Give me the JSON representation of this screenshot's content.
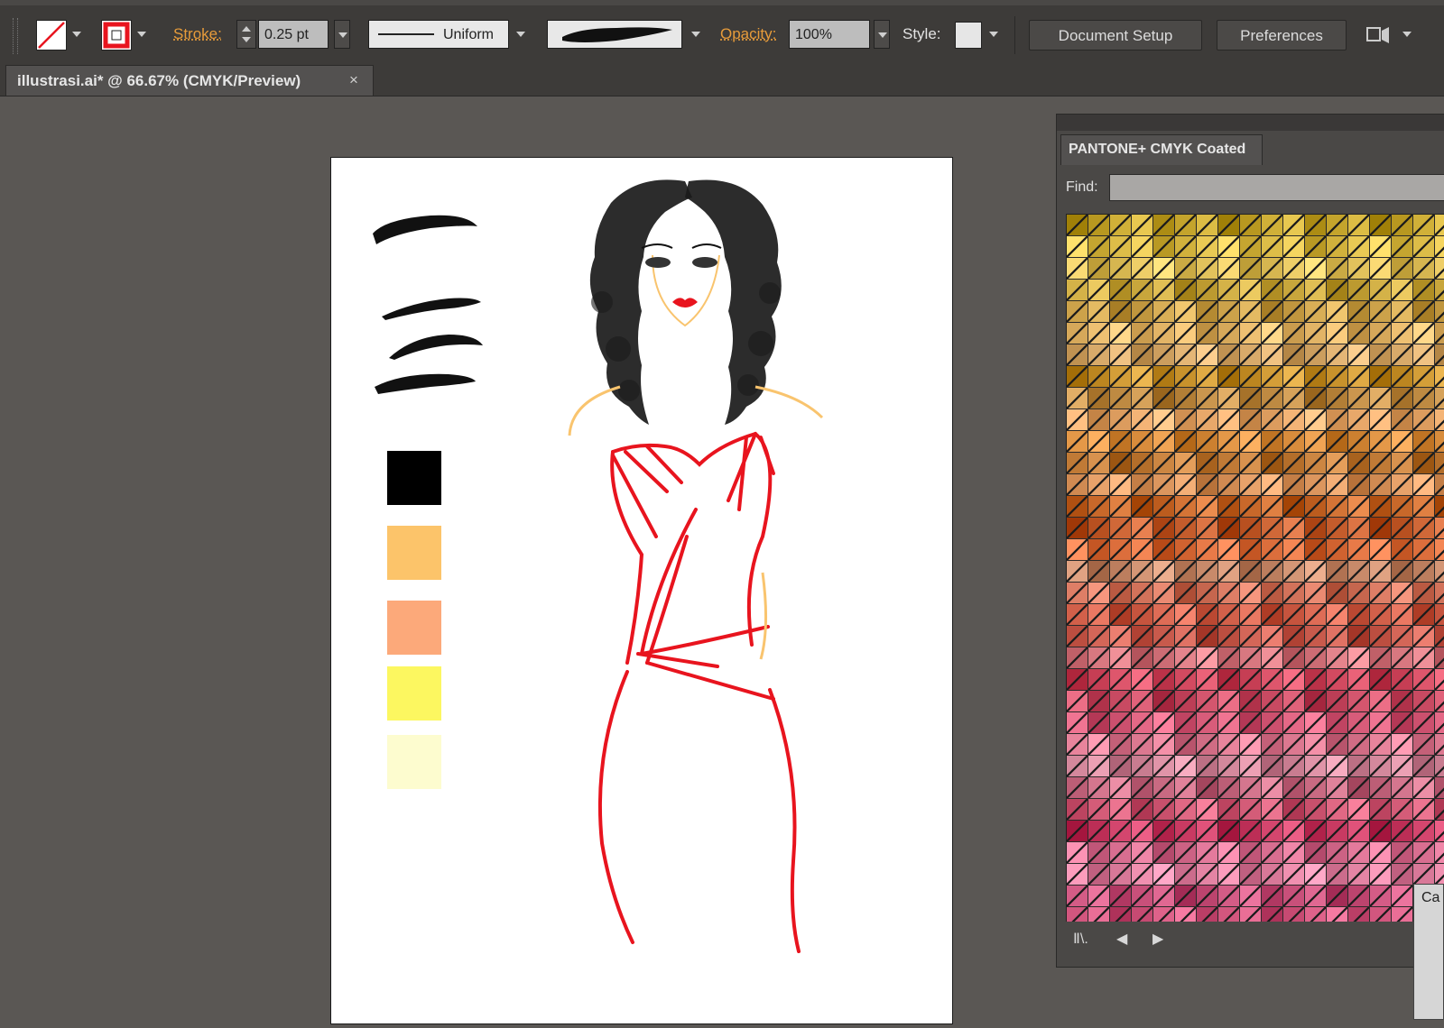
{
  "control_bar": {
    "stroke_label": "Stroke:",
    "stroke_weight": "0.25 pt",
    "profile_label": "Uniform",
    "opacity_label": "Opacity:",
    "opacity_value": "100%",
    "style_label": "Style:",
    "document_setup": "Document Setup",
    "preferences": "Preferences"
  },
  "document_tab": {
    "title": "illustrasi.ai* @ 66.67% (CMYK/Preview)",
    "close": "×"
  },
  "artboard": {
    "swatches": [
      "#000000",
      "#fcc46a",
      "#fca97a",
      "#fcf760",
      "#fdfccf"
    ]
  },
  "swatch_panel": {
    "title": "PANTONE+ CMYK Coated",
    "find_label": "Find:",
    "find_value": "",
    "row_colors": [
      "#c4a42c",
      "#ddbd48",
      "#e2c25c",
      "#c8a63c",
      "#cca24a",
      "#e2b466",
      "#d8aa6a",
      "#c8922c",
      "#be8a42",
      "#e8a86a",
      "#d88c3c",
      "#c07a36",
      "#dc965e",
      "#c8682a",
      "#c45c2c",
      "#dc6e3c",
      "#c88a6a",
      "#d2725a",
      "#d2604a",
      "#c85a4c",
      "#d87880",
      "#d24a60",
      "#c84a62",
      "#d85c7a",
      "#dc7890",
      "#d4889c",
      "#c86a82",
      "#d45c78",
      "#c83a62",
      "#d86e90",
      "#e484a4",
      "#c8507a",
      "#d2567e"
    ],
    "footer_prev": "◀",
    "footer_next": "▶",
    "footer_lib": "Ⅱ\\."
  },
  "lower_panel": {
    "label": "Ca"
  },
  "colors": {
    "accent_orange": "#e69b3a",
    "dress_red": "#e8141e",
    "skin_outline": "#f9c46e"
  }
}
